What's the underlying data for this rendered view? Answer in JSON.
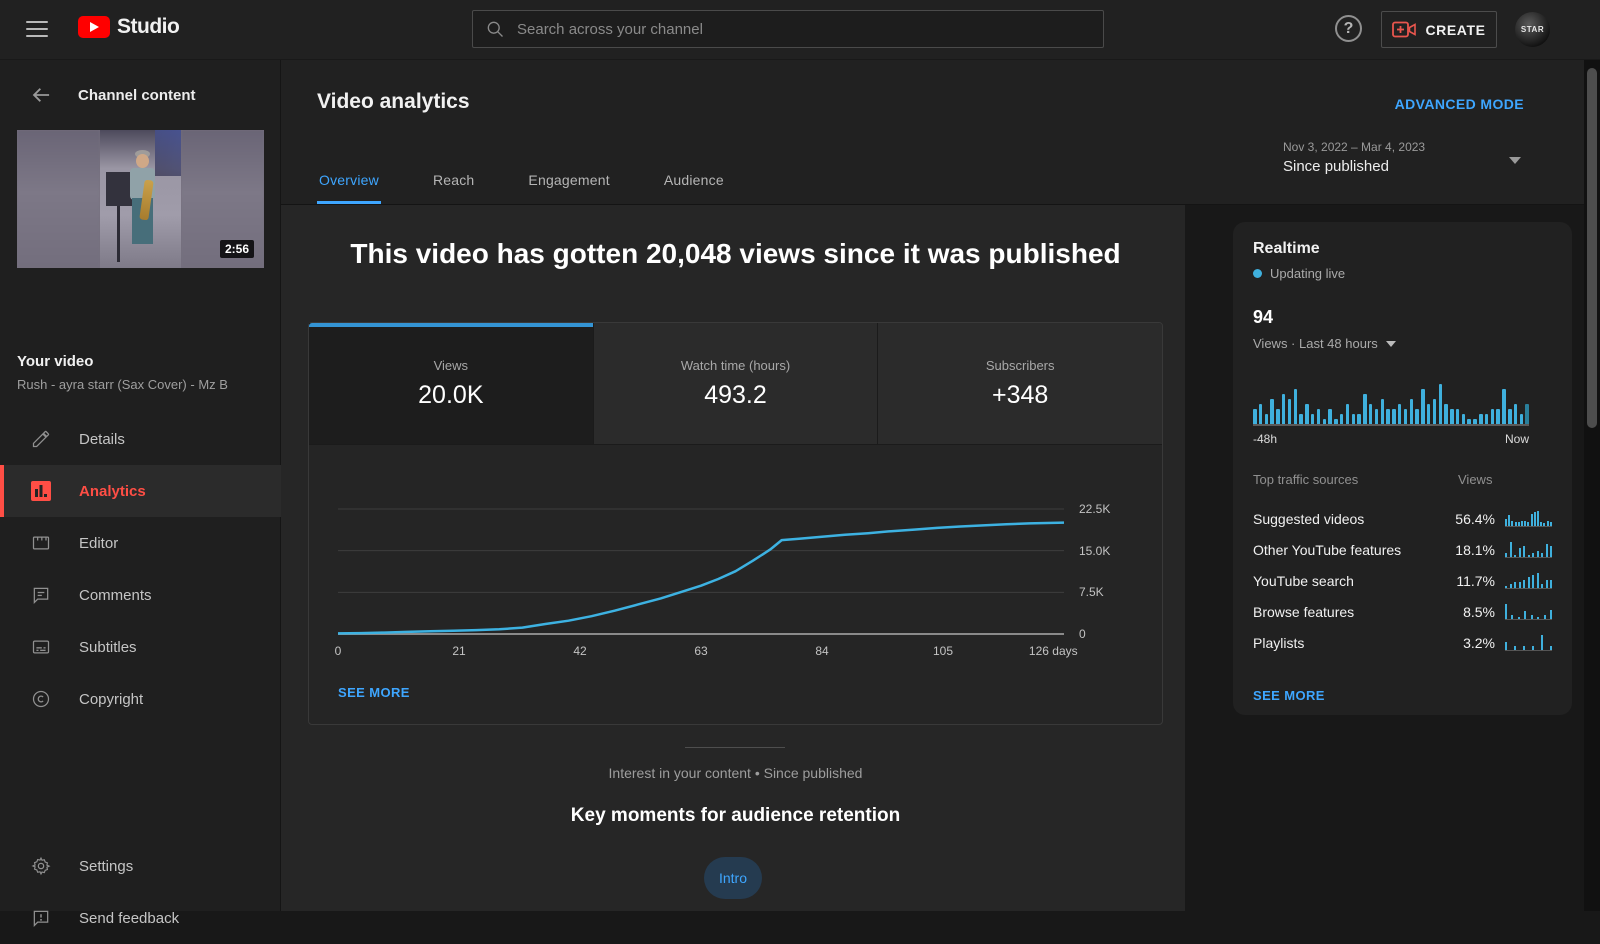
{
  "colors": {
    "accent_blue": "#3ea6ff",
    "chart_cyan": "#3fb0dd",
    "line_cyan": "#3db2e2",
    "active_red": "#ff4e45",
    "selected_tab_bar": "#3494d4"
  },
  "topbar": {
    "brand": "Studio",
    "search_placeholder": "Search across your channel",
    "create_label": "CREATE",
    "avatar_text": "STAR"
  },
  "sidebar": {
    "back_title": "Channel content",
    "video": {
      "duration": "2:56",
      "label": "Your video",
      "title": "Rush - ayra starr (Sax Cover) - Mz B"
    },
    "items": [
      {
        "label": "Details"
      },
      {
        "label": "Analytics",
        "active": true
      },
      {
        "label": "Editor"
      },
      {
        "label": "Comments"
      },
      {
        "label": "Subtitles"
      },
      {
        "label": "Copyright"
      }
    ],
    "footer_items": [
      {
        "label": "Settings"
      },
      {
        "label": "Send feedback"
      }
    ]
  },
  "header": {
    "title": "Video analytics",
    "advanced_mode": "ADVANCED MODE",
    "tabs": [
      "Overview",
      "Reach",
      "Engagement",
      "Audience"
    ],
    "active_tab": "Overview",
    "date_range": "Nov 3, 2022 – Mar 4, 2023",
    "date_mode": "Since published"
  },
  "main": {
    "headline": "This video has gotten 20,048 views since it was published",
    "metrics": [
      {
        "label": "Views",
        "value": "20.0K",
        "selected": true
      },
      {
        "label": "Watch time (hours)",
        "value": "493.2"
      },
      {
        "label": "Subscribers",
        "value": "+348"
      }
    ],
    "see_more": "SEE MORE",
    "interest_caption": "Interest in your content • Since published",
    "key_moments_title": "Key moments for audience retention",
    "intro_chip": "Intro"
  },
  "realtime": {
    "title": "Realtime",
    "live_label": "Updating live",
    "count": "94",
    "sub_label": "Views · Last 48 hours",
    "axis_left": "-48h",
    "axis_right": "Now",
    "see_more": "SEE MORE"
  },
  "traffic": {
    "col1": "Top traffic sources",
    "col2": "Views"
  },
  "chart_data": [
    {
      "id": "views-since-published",
      "type": "line",
      "title": "Views since published",
      "xlabel": "days",
      "ylabel": "Views",
      "xlim": [
        0,
        126
      ],
      "ylim": [
        0,
        22500
      ],
      "x_ticks": [
        "0",
        "21",
        "42",
        "63",
        "84",
        "105",
        "126 days"
      ],
      "x_tick_days": [
        0,
        21,
        42,
        63,
        84,
        105,
        126
      ],
      "y_ticks": [
        "0",
        "7.5K",
        "15.0K",
        "22.5K"
      ],
      "y_tick_values": [
        0,
        7500,
        15000,
        22500
      ],
      "grid": true,
      "series": [
        {
          "name": "Views",
          "color": "#3db2e2",
          "points": [
            [
              0,
              100
            ],
            [
              4,
              160
            ],
            [
              8,
              260
            ],
            [
              12,
              380
            ],
            [
              16,
              500
            ],
            [
              20,
              600
            ],
            [
              24,
              700
            ],
            [
              28,
              850
            ],
            [
              32,
              1150
            ],
            [
              36,
              1800
            ],
            [
              40,
              2400
            ],
            [
              44,
              3200
            ],
            [
              48,
              4200
            ],
            [
              52,
              5300
            ],
            [
              56,
              6400
            ],
            [
              60,
              7700
            ],
            [
              63,
              8700
            ],
            [
              66,
              9900
            ],
            [
              69,
              11300
            ],
            [
              72,
              13200
            ],
            [
              75,
              15200
            ],
            [
              77,
              16900
            ],
            [
              80,
              17150
            ],
            [
              84,
              17500
            ],
            [
              88,
              17850
            ],
            [
              92,
              18150
            ],
            [
              96,
              18500
            ],
            [
              100,
              18800
            ],
            [
              104,
              19100
            ],
            [
              108,
              19350
            ],
            [
              112,
              19550
            ],
            [
              116,
              19750
            ],
            [
              120,
              19900
            ],
            [
              126,
              20048
            ]
          ]
        }
      ]
    },
    {
      "id": "realtime-last-48h",
      "type": "bar",
      "title": "Views · Last 48 hours",
      "total_views": 94,
      "x_range": [
        "-48h",
        "Now"
      ],
      "bar_color": "#3fb0dd",
      "last_bar_color": "#2a7f9b",
      "values": [
        3,
        4,
        2,
        5,
        3,
        6,
        5,
        7,
        2,
        4,
        2,
        3,
        1,
        3,
        1,
        2,
        4,
        2,
        2,
        6,
        4,
        3,
        5,
        3,
        3,
        4,
        3,
        5,
        3,
        7,
        4,
        5,
        8,
        4,
        3,
        3,
        2,
        1,
        1,
        2,
        2,
        3,
        3,
        7,
        3,
        4,
        2,
        4
      ]
    },
    {
      "id": "top-traffic-sources",
      "type": "table",
      "columns": [
        "Top traffic sources",
        "Views"
      ],
      "rows": [
        {
          "label": "Suggested videos",
          "pct": "56.4%",
          "spark": [
            5,
            8,
            4,
            3,
            3,
            4,
            4,
            3,
            9,
            10,
            11,
            3,
            2,
            4,
            3
          ]
        },
        {
          "label": "Other YouTube features",
          "pct": "18.1%",
          "spark": [
            2,
            7,
            1,
            4,
            5,
            1,
            2,
            3,
            2,
            6,
            5
          ]
        },
        {
          "label": "YouTube search",
          "pct": "11.7%",
          "spark": [
            1,
            2,
            3,
            3,
            4,
            6,
            7,
            8,
            2,
            4,
            4
          ]
        },
        {
          "label": "Browse features",
          "pct": "8.5%",
          "spark": [
            8,
            2,
            1,
            4,
            2,
            1,
            2,
            5
          ]
        },
        {
          "label": "Playlists",
          "pct": "3.2%",
          "spark": [
            2,
            1,
            1,
            1,
            4,
            1
          ]
        }
      ]
    }
  ]
}
